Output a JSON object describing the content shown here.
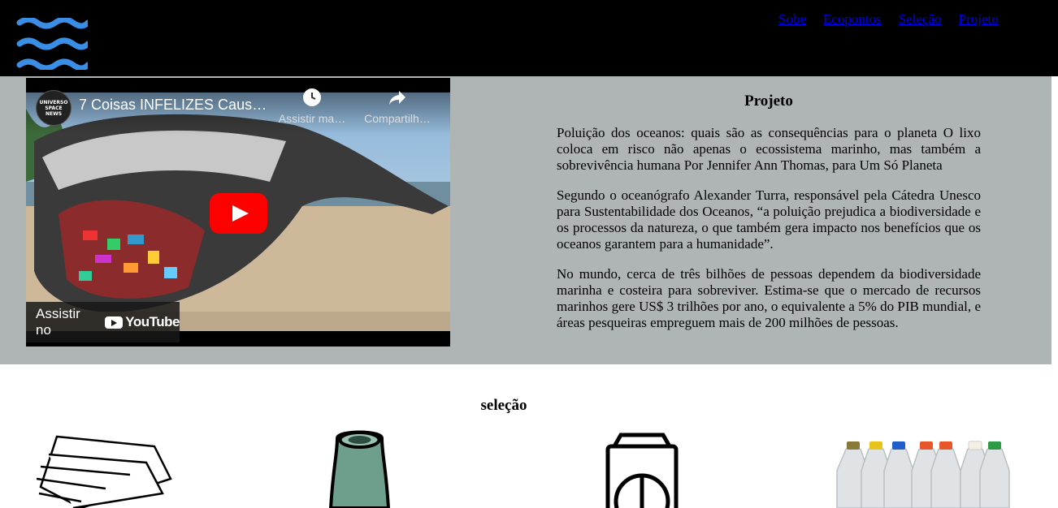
{
  "nav": {
    "items": [
      "Sobe",
      "Ecopontos",
      "Seleção",
      "Projeto"
    ]
  },
  "video": {
    "channel_badge": "UNIVERSO SPACE NEWS",
    "title": "7 Coisas INFELIZES Caus…",
    "watch_later": "Assistir ma…",
    "share": "Compartilh…",
    "watch_on": "Assistir no",
    "youtube": "YouTube"
  },
  "project": {
    "title": "Projeto",
    "paragraphs": [
      "Poluição dos oceanos: quais são as consequências para o planeta O lixo coloca em risco não apenas o ecossistema marinho, mas também a sobrevivência humana Por Jennifer Ann Thomas, para Um Só Planeta",
      "Segundo o oceanógrafo Alexander Turra, responsável pela Cátedra Unesco para Sustentabilidade dos Oceanos, “a poluição prejudica a biodiversidade e os processos da natureza, o que também gera impacto nos benefícios que os oceanos garantem para a humanidade”.",
      "No mundo, cerca de três bilhões de pessoas dependem da biodiversidade marinha e costeira para sobreviver. Estima-se que o mercado de recursos marinhos gere US$ 3 trilhões por ano, o equivalente a 5% do PIB mundial, e áreas pesqueiras empreguem mais de 200 milhões de pessoas."
    ]
  },
  "selection": {
    "title": "seleção"
  },
  "colors": {
    "header_bg": "#000000",
    "section_bg": "#afb4b4",
    "logo": "#3a8ee6",
    "link": "#0000ee",
    "yt_red": "#ff0000"
  }
}
